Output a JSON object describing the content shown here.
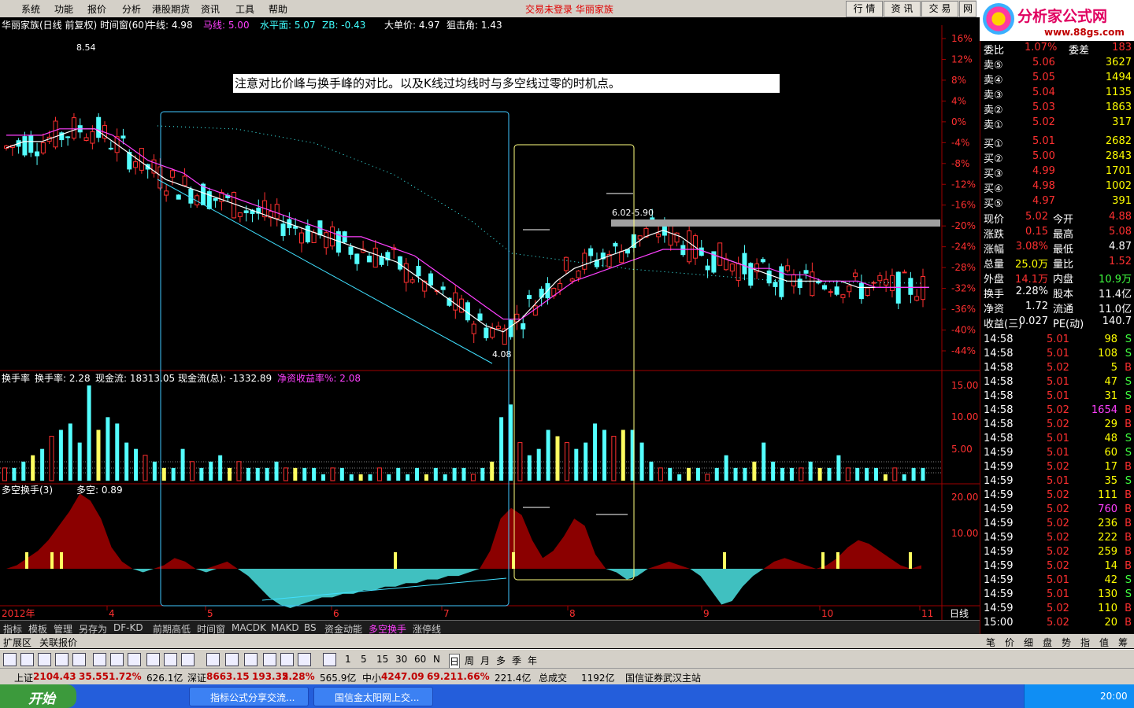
{
  "menu": [
    "系统",
    "功能",
    "报价",
    "分析",
    "港股期货",
    "资讯",
    "工具",
    "帮助"
  ],
  "login_status": "交易未登录  华丽家族",
  "right_buttons": [
    "行 情",
    "资 讯",
    "交 易",
    "网"
  ],
  "logo": {
    "title": "分析家公式网",
    "url": "www.88gs.com"
  },
  "chart_header": {
    "name": "华丽家族(日线 前复权) 时间窗(60)",
    "items": [
      {
        "label": "牛线: 4.98",
        "color": "#ffffff"
      },
      {
        "label": "马线: 5.00",
        "color": "#ff40ff"
      },
      {
        "label": "水平面: 5.07",
        "color": "#40ffff"
      },
      {
        "label": "ZB: -0.43",
        "color": "#40ffff"
      },
      {
        "label": "大单价: 4.97",
        "color": "#ffffff"
      },
      {
        "label": "狙击角: 1.43",
        "color": "#ffffff"
      }
    ]
  },
  "annotation": "注意对比价峰与换手峰的对比。以及K线过均线时与多空线过零的时机点。",
  "price_labels": {
    "high": "8.54",
    "low": "4.08",
    "range": "6.02-5.90"
  },
  "mid_header": {
    "name": "换手率",
    "items": [
      {
        "label": "换手率: 2.28",
        "color": "#ffffff"
      },
      {
        "label": "现金流: 18313.05",
        "color": "#ffffff"
      },
      {
        "label": "现金流(总): -1332.89",
        "color": "#ffffff"
      },
      {
        "label": "净资收益率%: 2.08",
        "color": "#ff40ff"
      }
    ]
  },
  "low_header": {
    "name": "多空换手(3)",
    "value": "多空: 0.89"
  },
  "x_axis": {
    "year": "2012年",
    "months": [
      "4",
      "5",
      "6",
      "7",
      "8",
      "9",
      "10",
      "11"
    ],
    "mode": "日线"
  },
  "chart_data": [
    {
      "type": "line",
      "panel": "price",
      "title": "华丽家族(日线 前复权)",
      "y_ticks": [
        "16%",
        "12%",
        "8%",
        "4%",
        "0%",
        "-4%",
        "-8%",
        "-12%",
        "-16%",
        "-20%",
        "-24%",
        "-28%",
        "-32%",
        "-36%",
        "-40%",
        "-44%"
      ],
      "series": [
        {
          "name": "牛线",
          "color": "#ffffff",
          "values": [
            7.2,
            7.3,
            7.3,
            7.4,
            7.5,
            7.5,
            7.3,
            7.1,
            6.9,
            6.7,
            6.6,
            6.5,
            6.4,
            6.3,
            6.2,
            6.1,
            6.0,
            5.9,
            5.8,
            5.7,
            5.6,
            5.5,
            5.4,
            5.2,
            5.0,
            4.8,
            4.6,
            4.4,
            4.3,
            4.5,
            4.8,
            5.1,
            5.3,
            5.4,
            5.5,
            5.6,
            5.8,
            5.9,
            5.8,
            5.6,
            5.5,
            5.4,
            5.3,
            5.2,
            5.1,
            5.1,
            5.1,
            5.1,
            5.0,
            5.0,
            5.0,
            5.0,
            5.0
          ]
        },
        {
          "name": "马线",
          "color": "#ff40ff",
          "values": [
            7.4,
            7.4,
            7.4,
            7.5,
            7.5,
            7.5,
            7.4,
            7.2,
            7.0,
            6.9,
            6.8,
            6.6,
            6.5,
            6.4,
            6.3,
            6.2,
            6.1,
            6.0,
            5.9,
            5.8,
            5.8,
            5.7,
            5.6,
            5.5,
            5.3,
            5.1,
            4.9,
            4.7,
            4.5,
            4.5,
            4.7,
            4.9,
            5.1,
            5.2,
            5.3,
            5.4,
            5.5,
            5.6,
            5.6,
            5.6,
            5.5,
            5.4,
            5.3,
            5.3,
            5.2,
            5.2,
            5.1,
            5.1,
            5.1,
            5.0,
            5.0,
            5.0,
            5.0
          ]
        }
      ]
    },
    {
      "type": "bar",
      "panel": "turnover",
      "title": "换手率",
      "y_ticks": [
        "15.00",
        "10.00",
        "5.00"
      ],
      "ylim": [
        0,
        17
      ],
      "series": [
        {
          "name": "换手率",
          "values": [
            2,
            2,
            3,
            4,
            5,
            7,
            8,
            9,
            6,
            15,
            8,
            10,
            9,
            6,
            5,
            4,
            3,
            2,
            2,
            5,
            3,
            2,
            3,
            4,
            2,
            3,
            2,
            2,
            2,
            3,
            2,
            2,
            2,
            2,
            1,
            2,
            2,
            1,
            1,
            1,
            2,
            1,
            2,
            1,
            2,
            1,
            2,
            1,
            2,
            2,
            1,
            2,
            3,
            10,
            12,
            6,
            4,
            5,
            8,
            7,
            6,
            5,
            6,
            9,
            8,
            7,
            8,
            8,
            6,
            3,
            2,
            2,
            1,
            2,
            2,
            1,
            2,
            4,
            2,
            2,
            3,
            6,
            3,
            2,
            2,
            2,
            3,
            2,
            2,
            4,
            2,
            2,
            2,
            2,
            1,
            2,
            1,
            2,
            2
          ]
        }
      ]
    },
    {
      "type": "area",
      "panel": "long_short",
      "title": "多空换手(3)",
      "y_ticks": [
        "20.00",
        "10.00"
      ],
      "ylim": [
        -12,
        22
      ],
      "series": [
        {
          "name": "多空",
          "values": [
            0,
            1,
            3,
            5,
            8,
            12,
            16,
            21,
            19,
            14,
            6,
            2,
            0,
            -1,
            0,
            1,
            3,
            2,
            0,
            -1,
            1,
            2,
            0,
            -2,
            -5,
            -8,
            -10,
            -11,
            -10,
            -9,
            -8,
            -8,
            -7,
            -7,
            -6,
            -6,
            -5,
            -5,
            -4,
            -4,
            -3,
            -3,
            -2,
            -2,
            -1,
            0,
            5,
            14,
            17,
            15,
            8,
            3,
            5,
            9,
            14,
            12,
            4,
            0,
            -1,
            -3,
            -2,
            0,
            1,
            2,
            1,
            0,
            -2,
            -6,
            -10,
            -9,
            -5,
            -2,
            0,
            2,
            3,
            2,
            1,
            0,
            1,
            3,
            6,
            8,
            7,
            5,
            3,
            1,
            0,
            1
          ]
        }
      ]
    }
  ],
  "quote": {
    "top": {
      "label1": "委比",
      "val1": "1.07%",
      "label2": "委差",
      "val2": "183"
    },
    "sells": [
      {
        "label": "卖⑤",
        "price": "5.06",
        "vol": "3627"
      },
      {
        "label": "卖④",
        "price": "5.05",
        "vol": "1494"
      },
      {
        "label": "卖③",
        "price": "5.04",
        "vol": "1135"
      },
      {
        "label": "卖②",
        "price": "5.03",
        "vol": "1863"
      },
      {
        "label": "卖①",
        "price": "5.02",
        "vol": "317"
      }
    ],
    "buys": [
      {
        "label": "买①",
        "price": "5.01",
        "vol": "2682"
      },
      {
        "label": "买②",
        "price": "5.00",
        "vol": "2843"
      },
      {
        "label": "买③",
        "price": "4.99",
        "vol": "1701"
      },
      {
        "label": "买④",
        "price": "4.98",
        "vol": "1002"
      },
      {
        "label": "买⑤",
        "price": "4.97",
        "vol": "391"
      }
    ],
    "stats": [
      {
        "l1": "现价",
        "v1": "5.02",
        "c1": "#ff3030",
        "l2": "今开",
        "v2": "4.88",
        "c2": "#ff3030"
      },
      {
        "l1": "涨跌",
        "v1": "0.15",
        "c1": "#ff3030",
        "l2": "最高",
        "v2": "5.08",
        "c2": "#ff3030"
      },
      {
        "l1": "涨幅",
        "v1": "3.08%",
        "c1": "#ff3030",
        "l2": "最低",
        "v2": "4.87",
        "c2": "#ffffff"
      },
      {
        "l1": "总量",
        "v1": "25.0万",
        "c1": "#ffff00",
        "l2": "量比",
        "v2": "1.52",
        "c2": "#ff3030"
      },
      {
        "l1": "外盘",
        "v1": "14.1万",
        "c1": "#ff3030",
        "l2": "内盘",
        "v2": "10.9万",
        "c2": "#40ff40"
      },
      {
        "l1": "换手",
        "v1": "2.28%",
        "c1": "#ffffff",
        "l2": "股本",
        "v2": "11.4亿",
        "c2": "#ffffff"
      },
      {
        "l1": "净资",
        "v1": "1.72",
        "c1": "#ffffff",
        "l2": "流通",
        "v2": "11.0亿",
        "c2": "#ffffff"
      },
      {
        "l1": "收益(三)",
        "v1": "0.027",
        "c1": "#ffffff",
        "l2": "PE(动)",
        "v2": "140.7",
        "c2": "#ffffff"
      }
    ],
    "ticks": [
      {
        "t": "14:58",
        "p": "5.01",
        "v": "98",
        "s": "S"
      },
      {
        "t": "14:58",
        "p": "5.01",
        "v": "108",
        "s": "S"
      },
      {
        "t": "14:58",
        "p": "5.02",
        "v": "5",
        "s": "B"
      },
      {
        "t": "14:58",
        "p": "5.01",
        "v": "47",
        "s": "S"
      },
      {
        "t": "14:58",
        "p": "5.01",
        "v": "31",
        "s": "S"
      },
      {
        "t": "14:58",
        "p": "5.02",
        "v": "1654",
        "s": "B"
      },
      {
        "t": "14:58",
        "p": "5.02",
        "v": "29",
        "s": "B"
      },
      {
        "t": "14:58",
        "p": "5.01",
        "v": "48",
        "s": "S"
      },
      {
        "t": "14:59",
        "p": "5.01",
        "v": "60",
        "s": "S"
      },
      {
        "t": "14:59",
        "p": "5.02",
        "v": "17",
        "s": "B"
      },
      {
        "t": "14:59",
        "p": "5.01",
        "v": "35",
        "s": "S"
      },
      {
        "t": "14:59",
        "p": "5.02",
        "v": "111",
        "s": "B"
      },
      {
        "t": "14:59",
        "p": "5.02",
        "v": "760",
        "s": "B"
      },
      {
        "t": "14:59",
        "p": "5.02",
        "v": "236",
        "s": "B"
      },
      {
        "t": "14:59",
        "p": "5.02",
        "v": "222",
        "s": "B"
      },
      {
        "t": "14:59",
        "p": "5.02",
        "v": "259",
        "s": "B"
      },
      {
        "t": "14:59",
        "p": "5.02",
        "v": "14",
        "s": "B"
      },
      {
        "t": "14:59",
        "p": "5.01",
        "v": "42",
        "s": "S"
      },
      {
        "t": "14:59",
        "p": "5.01",
        "v": "130",
        "s": "S"
      },
      {
        "t": "14:59",
        "p": "5.02",
        "v": "110",
        "s": "B"
      },
      {
        "t": "15:00",
        "p": "5.02",
        "v": "20",
        "s": "B"
      }
    ]
  },
  "bottom_tabs": [
    "指标",
    "模板",
    "管理",
    "另存为",
    "DF-KD",
    "前期高低",
    "时间窗",
    "MACDK",
    "MAKD",
    "BS",
    "资金动能",
    "多空换手",
    "涨停线"
  ],
  "ext_tabs": [
    "扩展区",
    "关联报价"
  ],
  "quote_tabs": [
    "笔",
    "价",
    "细",
    "盘",
    "势",
    "指",
    "值",
    "筹"
  ],
  "periods": [
    "1",
    "5",
    "15",
    "30",
    "60",
    "N",
    "日",
    "周",
    "月",
    "多",
    "季",
    "年"
  ],
  "index_bar": [
    {
      "name": "上证",
      "pts": "2104.43",
      "chg": "35.55",
      "pct": "1.72%",
      "amt": "626.1亿"
    },
    {
      "name": "深证",
      "pts": "8663.15",
      "chg": "193.35",
      "pct": "2.28%",
      "amt": "565.9亿"
    },
    {
      "name": "中小",
      "pts": "4247.09",
      "chg": "69.21",
      "pct": "1.66%",
      "amt": "221.4亿"
    }
  ],
  "index_extra": {
    "label": "总成交",
    "val": "1192亿",
    "site": "国信证券武汉主站"
  },
  "taskbar": {
    "start": "开始",
    "items": [
      "指标公式分享交流...",
      "国信金太阳网上交..."
    ],
    "clock": "20:00"
  }
}
